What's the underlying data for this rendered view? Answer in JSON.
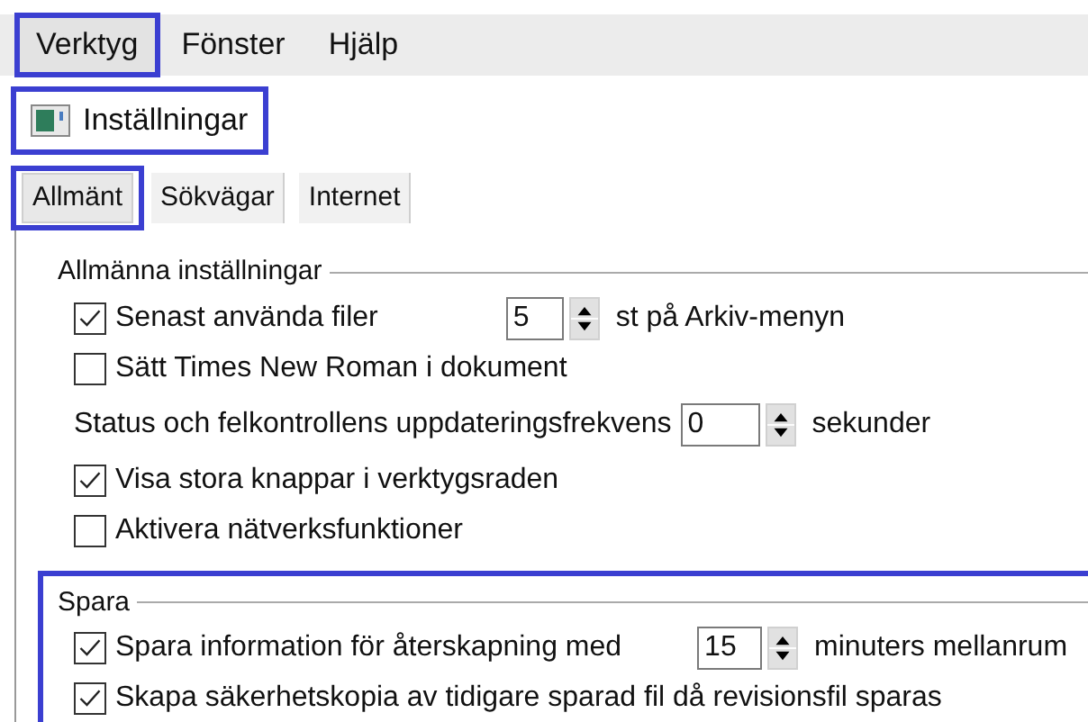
{
  "menu": [
    {
      "label": "Verktyg",
      "highlighted": true
    },
    {
      "label": "Fönster",
      "highlighted": false
    },
    {
      "label": "Hjälp",
      "highlighted": false
    }
  ],
  "toolbar_item": {
    "label": "Inställningar",
    "highlighted": true
  },
  "tabs": [
    {
      "label": "Allmänt",
      "selected": true
    },
    {
      "label": "Sökvägar",
      "selected": false
    },
    {
      "label": "Internet",
      "selected": false
    }
  ],
  "groups": [
    {
      "title": "Allmänna inställningar",
      "highlighted": false,
      "rows": [
        {
          "kind": "checkbox",
          "label": "Senast använda filer",
          "checked": true,
          "value": "5",
          "suffix": "st på Arkiv-menyn"
        },
        {
          "kind": "checkbox",
          "label": "Sätt Times New Roman i dokument",
          "checked": false
        },
        {
          "kind": "spin",
          "label": "Status och felkontrollens uppdateringsfrekvens",
          "value": "0",
          "suffix": "sekunder"
        },
        {
          "kind": "checkbox",
          "label": "Visa stora knappar i verktygsraden",
          "checked": true
        },
        {
          "kind": "checkbox",
          "label": "Aktivera nätverksfunktioner",
          "checked": false
        }
      ]
    },
    {
      "title": "Spara",
      "highlighted": true,
      "rows": [
        {
          "kind": "checkbox",
          "label": "Spara information för återskapning med",
          "checked": true,
          "value": "15",
          "suffix": "minuters mellanrum"
        },
        {
          "kind": "checkbox",
          "label": "Skapa säkerhetskopia av tidigare sparad fil då revisionsfil sparas",
          "checked": true
        }
      ]
    }
  ]
}
